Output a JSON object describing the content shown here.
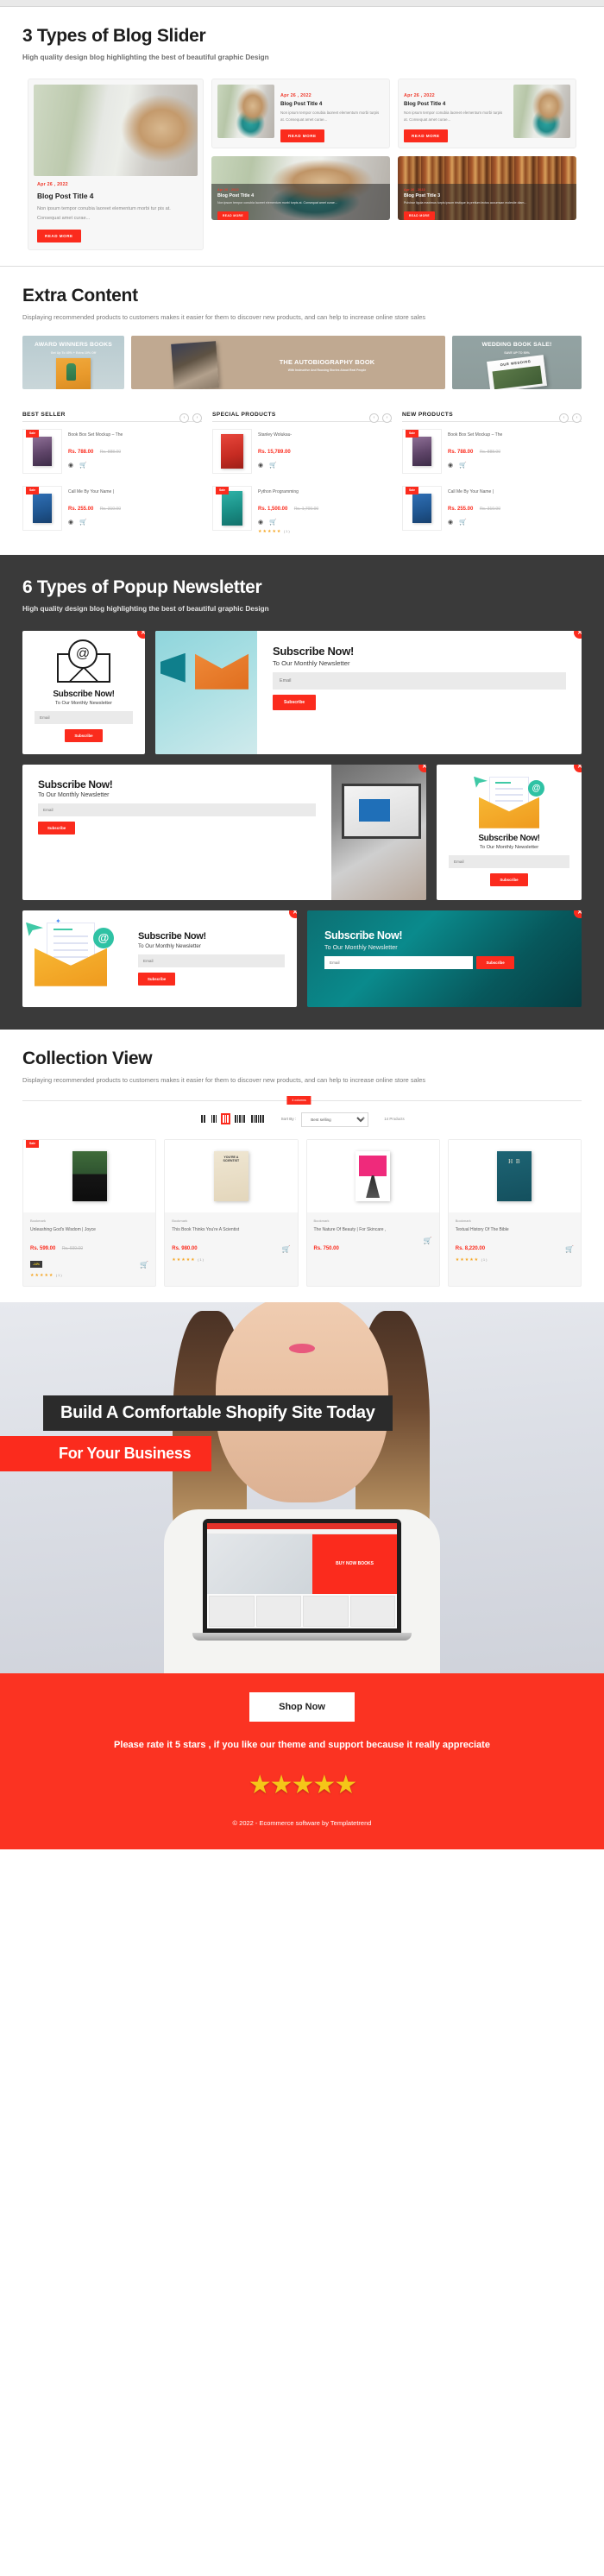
{
  "blog_section": {
    "title": "3 Types of Blog Slider",
    "subtitle": "High quality design blog highlighting the best of beautiful graphic Design",
    "featured": {
      "date": "Apr 26 , 2022",
      "title": "Blog Post Title 4",
      "excerpt": "Non ipsum tempor conubia laoreet elementum morbi tur pis at. Consequat amet curae...",
      "button": "READ MORE"
    },
    "side_cards": [
      {
        "date": "Apr 26 , 2022",
        "title": "Blog Post Title 4",
        "excerpt": "Non ipsum tempor conubia laoreet elementum morbi turpis at. Consequat amet curae...",
        "button": "READ MORE"
      },
      {
        "date": "Apr 26 , 2022",
        "title": "Blog Post Title 4",
        "excerpt": "Non ipsum tempor conubia laoreet elementum morbi turpis at. Consequat amet curae...",
        "button": "READ MORE"
      }
    ],
    "overlay_cards": [
      {
        "date": "Apr 26 , 2022",
        "title": "Blog Post Title 4",
        "excerpt": "Non ipsum tempor conubia laoreet elementum morbi turpis at. Consequat amet curae...",
        "button": "READ MORE"
      },
      {
        "date": "Apr 26 , 2022",
        "title": "Blog Post Title 3",
        "excerpt": "Pulvinar ligula maximus turpis ipsum tristique la pretium lectus accumsan molestie diam...",
        "button": "READ MORE"
      }
    ]
  },
  "extra_content": {
    "title": "Extra Content",
    "subtitle": "Displaying recommended products to customers makes it easier for them to discover new products, and can help to increase online store sales",
    "banners": [
      {
        "title": "AWARD WINNERS BOOKS",
        "subtitle": "Get Up To 45% + Extra 10% Off"
      },
      {
        "title": "THE AUTOBIOGRAPHY BOOK",
        "subtitle": "With Instructive And Rousing Stories About Real People"
      },
      {
        "title": "WEDDING BOOK SALE!",
        "subtitle": "SAVE UP TO 50%",
        "cover_text": "OUR WEDDING"
      }
    ],
    "product_columns": [
      {
        "title": "BEST SELLER",
        "products": [
          {
            "badge": "Sale",
            "name": "Book Box Set Mockup – The",
            "price": "Rs. 788.00",
            "old_price": "Rs. 888.00",
            "rating": null
          },
          {
            "badge": "Sale",
            "name": "Call Me By Your Name |",
            "price": "Rs. 255.00",
            "old_price": "Rs. 310.00",
            "rating": null
          }
        ]
      },
      {
        "title": "SPECIAL PRODUCTS",
        "products": [
          {
            "badge": null,
            "name": "Stanley Wolukau-",
            "price": "Rs. 15,789.00",
            "old_price": null,
            "rating": null
          },
          {
            "badge": "Sale",
            "name": "Python Programming",
            "price": "Rs. 1,500.00",
            "old_price": "Rs. 1,700.00",
            "rating": "(1)"
          }
        ]
      },
      {
        "title": "NEW PRODUCTS",
        "products": [
          {
            "badge": "Sale",
            "name": "Book Box Set Mockup – The",
            "price": "Rs. 788.00",
            "old_price": "Rs. 888.00",
            "rating": null
          },
          {
            "badge": "Sale",
            "name": "Call Me By Your Name |",
            "price": "Rs. 255.00",
            "old_price": "Rs. 310.00",
            "rating": null
          }
        ]
      }
    ],
    "nav_prev": "‹",
    "nav_next": "›"
  },
  "popup_section": {
    "title": "6 Types of Popup Newsletter",
    "subtitle": "High quality design blog highlighting the best of beautiful graphic Design",
    "close_label": "✕",
    "popups": [
      {
        "heading": "Subscribe Now!",
        "sub": "To Our Monthly Newsletter",
        "placeholder": "Email",
        "button": "Subscribe"
      },
      {
        "heading": "Subscribe Now!",
        "sub": "To Our Monthly Newsletter",
        "placeholder": "Email",
        "button": "Subscribe"
      },
      {
        "heading": "Subscribe Now!",
        "sub": "To Our Monthly Newsletter",
        "placeholder": "Email",
        "button": "Subscribe"
      },
      {
        "heading": "Subscribe Now!",
        "sub": "To Our Monthly Newsletter",
        "placeholder": "Email",
        "button": "Subscribe"
      },
      {
        "heading": "Subscribe Now!",
        "sub": "To Our Monthly Newsletter",
        "placeholder": "Email",
        "button": "Subscribe"
      },
      {
        "heading": "Subscribe Now!",
        "sub": "To Our Monthly Newsletter",
        "placeholder": "Email",
        "button": "Subscribe"
      }
    ]
  },
  "collection": {
    "title": "Collection View",
    "subtitle": "Displaying recommended products to customers makes it easier for them to discover new products, and can help to increase online store sales",
    "column_tooltip": "4 columns",
    "sort_label": "Sort By :",
    "sort_value": "Best selling",
    "product_count": "14 Products",
    "products": [
      {
        "badge": "Sale",
        "vendor": "Bookmark",
        "name": "Unleashing God's Wisdom | Joyce",
        "price": "Rs. 599.00",
        "old_price": "Rs. 699.00",
        "discount": "-14%",
        "rating": "(1)"
      },
      {
        "badge": null,
        "vendor": "Bookmark",
        "name": "This Book Thinks You're A Scientist",
        "price": "Rs. 980.00",
        "old_price": null,
        "discount": null,
        "rating": "(1)"
      },
      {
        "badge": null,
        "vendor": "Bookmark",
        "name": "The Nature Of Beauty | For Skincare ,",
        "price": "Rs. 750.00",
        "old_price": null,
        "discount": null,
        "rating": null
      },
      {
        "badge": null,
        "vendor": "Bookmark",
        "name": "Textual History Of The Bible",
        "price": "Rs. 8,220.00",
        "old_price": null,
        "discount": null,
        "rating": "(1)"
      }
    ]
  },
  "promo": {
    "title": "Build A Comfortable Shopify Site Today",
    "subtitle": "For Your Business",
    "laptop_text": "BUY NOW BOOKS"
  },
  "footer": {
    "shop_button": "Shop Now",
    "rate_text": "Please rate it 5 stars , if you like our theme and support because it really appreciate",
    "stars": "★★★★★",
    "copyright": "© 2022 - Ecommerce software by Templatetrend"
  }
}
